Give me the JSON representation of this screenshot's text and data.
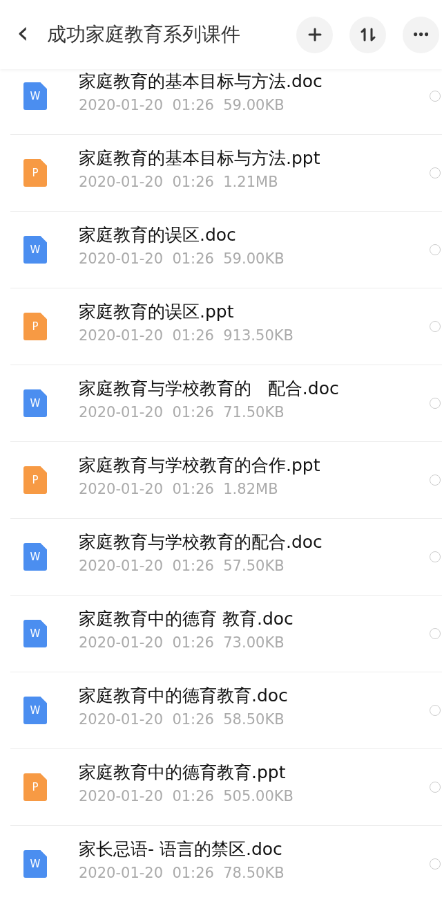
{
  "header": {
    "back": "‹",
    "title": "成功家庭教育系列课件",
    "actions": [
      {
        "kind": "add"
      },
      {
        "kind": "sort"
      },
      {
        "kind": "more"
      }
    ]
  },
  "files": [
    {
      "kind": "doc",
      "badge": "W",
      "name": "家庭教育的基本目标与方法.doc",
      "date": "2020-01-20",
      "time": "01:26",
      "size": "59.00KB",
      "selected": false
    },
    {
      "kind": "ppt",
      "badge": "P",
      "name": "家庭教育的基本目标与方法.ppt",
      "date": "2020-01-20",
      "time": "01:26",
      "size": "1.21MB",
      "selected": false
    },
    {
      "kind": "doc",
      "badge": "W",
      "name": "家庭教育的误区.doc",
      "date": "2020-01-20",
      "time": "01:26",
      "size": "59.00KB",
      "selected": false
    },
    {
      "kind": "ppt",
      "badge": "P",
      "name": "家庭教育的误区.ppt",
      "date": "2020-01-20",
      "time": "01:26",
      "size": "913.50KB",
      "selected": false
    },
    {
      "kind": "doc",
      "badge": "W",
      "name": "家庭教育与学校教育的   配合.doc",
      "date": "2020-01-20",
      "time": "01:26",
      "size": "71.50KB",
      "selected": false
    },
    {
      "kind": "ppt",
      "badge": "P",
      "name": "家庭教育与学校教育的合作.ppt",
      "date": "2020-01-20",
      "time": "01:26",
      "size": "1.82MB",
      "selected": false
    },
    {
      "kind": "doc",
      "badge": "W",
      "name": "家庭教育与学校教育的配合.doc",
      "date": "2020-01-20",
      "time": "01:26",
      "size": "57.50KB",
      "selected": false
    },
    {
      "kind": "doc",
      "badge": "W",
      "name": "家庭教育中的德育 教育.doc",
      "date": "2020-01-20",
      "time": "01:26",
      "size": "73.00KB",
      "selected": false
    },
    {
      "kind": "doc",
      "badge": "W",
      "name": "家庭教育中的德育教育.doc",
      "date": "2020-01-20",
      "time": "01:26",
      "size": "58.50KB",
      "selected": false
    },
    {
      "kind": "ppt",
      "badge": "P",
      "name": "家庭教育中的德育教育.ppt",
      "date": "2020-01-20",
      "time": "01:26",
      "size": "505.00KB",
      "selected": false
    },
    {
      "kind": "doc",
      "badge": "W",
      "name": "家长忌语- 语言的禁区.doc",
      "date": "2020-01-20",
      "time": "01:26",
      "size": "78.50KB",
      "selected": false
    }
  ]
}
